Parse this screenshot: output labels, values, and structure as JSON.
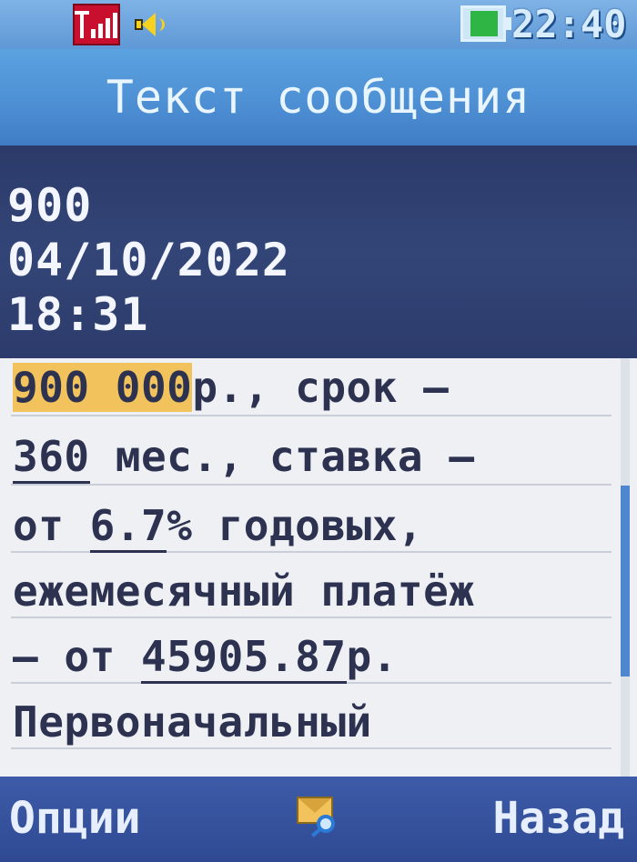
{
  "status_bar": {
    "signal_icon": "signal-icon",
    "speaker_icon": "speaker-icon",
    "battery_icon": "battery-icon",
    "time": "22:40"
  },
  "title": "Текст сообщения",
  "message": {
    "sender": "900",
    "date": "04/10/2022",
    "time": "18:31",
    "lines": [
      {
        "a": "900 000",
        "b": "р., срок –"
      },
      {
        "a": "360",
        "b": " мес., ставка –"
      },
      {
        "a": "от ",
        "b": "6.7",
        "c": "% годовых,"
      },
      {
        "a": "ежемесячный платёж"
      },
      {
        "a": "– от ",
        "b": "45905.87",
        "c": "р."
      },
      {
        "a": "Первоначальный"
      }
    ]
  },
  "softkeys": {
    "left": "Опции",
    "center_icon": "envelope-search-icon",
    "right": "Назад"
  },
  "colors": {
    "title_bar": "#4d8ed3",
    "header_bg": "#2c3a66",
    "body_bg": "#eef0f3",
    "highlight": "#f2c35c",
    "softkeys_bg": "#3d5ba8"
  }
}
